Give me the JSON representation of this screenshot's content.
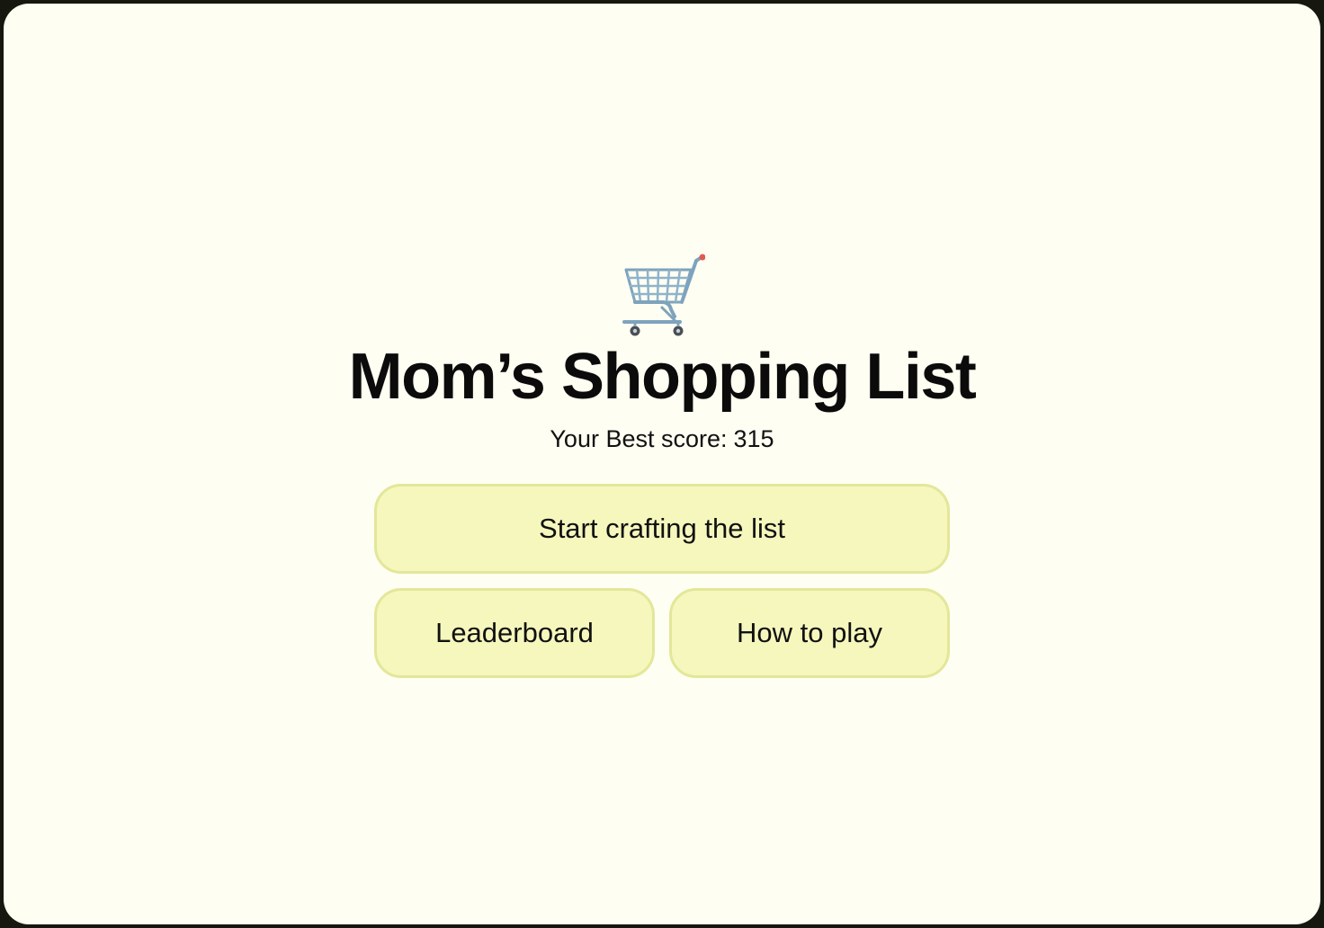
{
  "game": {
    "icon": "shopping-cart-icon",
    "title": "Mom’s Shopping List",
    "best_score_label": "Your Best score:",
    "best_score_value": "315"
  },
  "menu": {
    "start_label": "Start crafting the list",
    "leaderboard_label": "Leaderboard",
    "how_to_play_label": "How to play"
  },
  "colors": {
    "background": "#fefef2",
    "button_fill": "#f6f7bd",
    "button_border": "#e3e799",
    "text": "#0b0b0b"
  }
}
